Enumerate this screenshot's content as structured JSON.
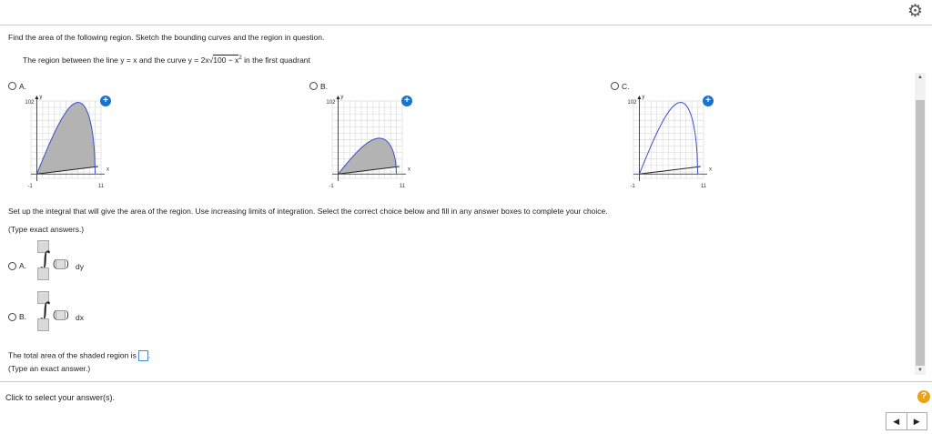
{
  "header": {
    "settings_icon": "gear-icon"
  },
  "question": {
    "prompt": "Find the area of the following region. Sketch the bounding curves and the region in question.",
    "region_prefix": "The region between the line y = x and the curve y = 2x",
    "region_radicand": "100 − x",
    "region_exp": "2",
    "region_suffix": "in the first quadrant"
  },
  "graph_options": [
    {
      "label": "A.",
      "ymax_label": "102",
      "xmin_label": "-1",
      "xmax_label": "11",
      "xaxis": "x",
      "yaxis": "y"
    },
    {
      "label": "B.",
      "ymax_label": "102",
      "xmin_label": "-1",
      "xmax_label": "11",
      "xaxis": "x",
      "yaxis": "y"
    },
    {
      "label": "C.",
      "ymax_label": "102",
      "xmin_label": "-1",
      "xmax_label": "11",
      "xaxis": "x",
      "yaxis": "y"
    }
  ],
  "setup_text": "Set up the integral that will give the area of the region. Use increasing limits of integration. Select the correct choice below and fill in any answer boxes to complete your choice.",
  "type_exact": "(Type exact answers.)",
  "integral_options": [
    {
      "label": "A.",
      "differential": "dy"
    },
    {
      "label": "B.",
      "differential": "dx"
    }
  ],
  "total_area_text": "The total area of the shaded region is",
  "total_area_end": ".",
  "type_exact_answer": "(Type an exact answer.)",
  "footer": {
    "click_text": "Click to select your answer(s).",
    "help": "?",
    "prev": "◀",
    "next": "▶"
  },
  "colors": {
    "curve": "#3d4fc6",
    "shade": "#b3b3b3",
    "zoom": "#1a73c8",
    "help": "#e8a317"
  }
}
